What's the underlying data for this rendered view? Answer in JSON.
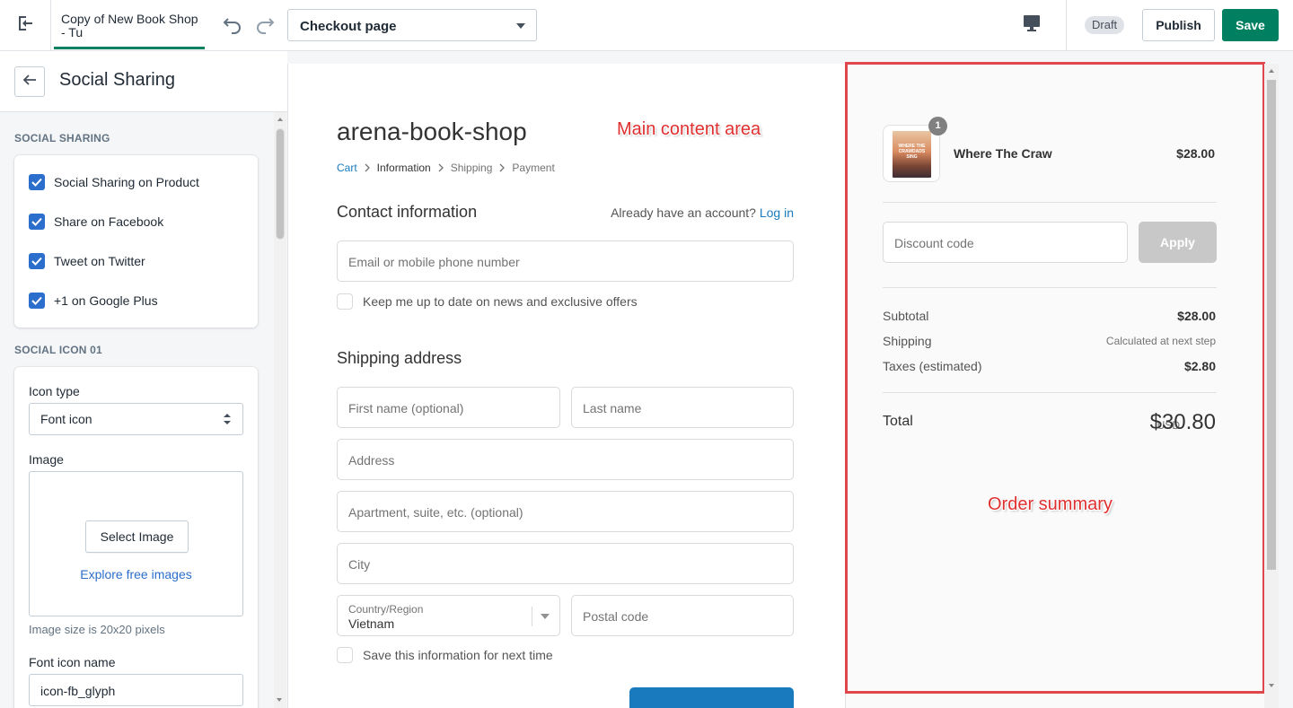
{
  "topbar": {
    "theme_title": "Copy of New Book Shop - Tu",
    "page_select_value": "Checkout page",
    "draft_badge": "Draft",
    "publish_label": "Publish",
    "save_label": "Save",
    "accent_color": "#008060"
  },
  "sidebar": {
    "title": "Social Sharing",
    "section_social_sharing": "SOCIAL SHARING",
    "checkboxes": [
      {
        "label": "Social Sharing on Product",
        "checked": true
      },
      {
        "label": "Share on Facebook",
        "checked": true
      },
      {
        "label": "Tweet on Twitter",
        "checked": true
      },
      {
        "label": "+1 on Google Plus",
        "checked": true
      }
    ],
    "section_icon": "SOCIAL ICON 01",
    "icon_type_label": "Icon type",
    "icon_type_value": "Font icon",
    "image_label": "Image",
    "select_image_label": "Select Image",
    "explore_link": "Explore free images",
    "image_help": "Image size is 20x20 pixels",
    "font_icon_label": "Font icon name",
    "font_icon_value": "icon-fb_glyph"
  },
  "checkout": {
    "shop_name": "arena-book-shop",
    "breadcrumb": [
      "Cart",
      "Information",
      "Shipping",
      "Payment"
    ],
    "contact_heading": "Contact information",
    "account_prompt": "Already have an account?",
    "login_link": "Log in",
    "email_placeholder": "Email or mobile phone number",
    "newsletter_label": "Keep me up to date on news and exclusive offers",
    "shipping_heading": "Shipping address",
    "first_name_placeholder": "First name (optional)",
    "last_name_placeholder": "Last name",
    "address_placeholder": "Address",
    "apartment_placeholder": "Apartment, suite, etc. (optional)",
    "city_placeholder": "City",
    "country_label": "Country/Region",
    "country_value": "Vietnam",
    "postal_placeholder": "Postal code",
    "save_info_label": "Save this information for next time",
    "link_color": "#197bbd"
  },
  "summary": {
    "product_name": "Where The Craw",
    "product_price": "$28.00",
    "quantity": "1",
    "cover_text": "WHERE THE CRAWDADS SING",
    "discount_placeholder": "Discount code",
    "apply_label": "Apply",
    "subtotal_label": "Subtotal",
    "subtotal_value": "$28.00",
    "shipping_label": "Shipping",
    "shipping_value": "Calculated at next step",
    "taxes_label": "Taxes (estimated)",
    "taxes_value": "$2.80",
    "total_label": "Total",
    "total_currency": "USD",
    "total_value": "$30.80"
  },
  "annotations": {
    "main_content": "Main content area",
    "order_summary": "Order summary",
    "color": "#e0474c"
  }
}
